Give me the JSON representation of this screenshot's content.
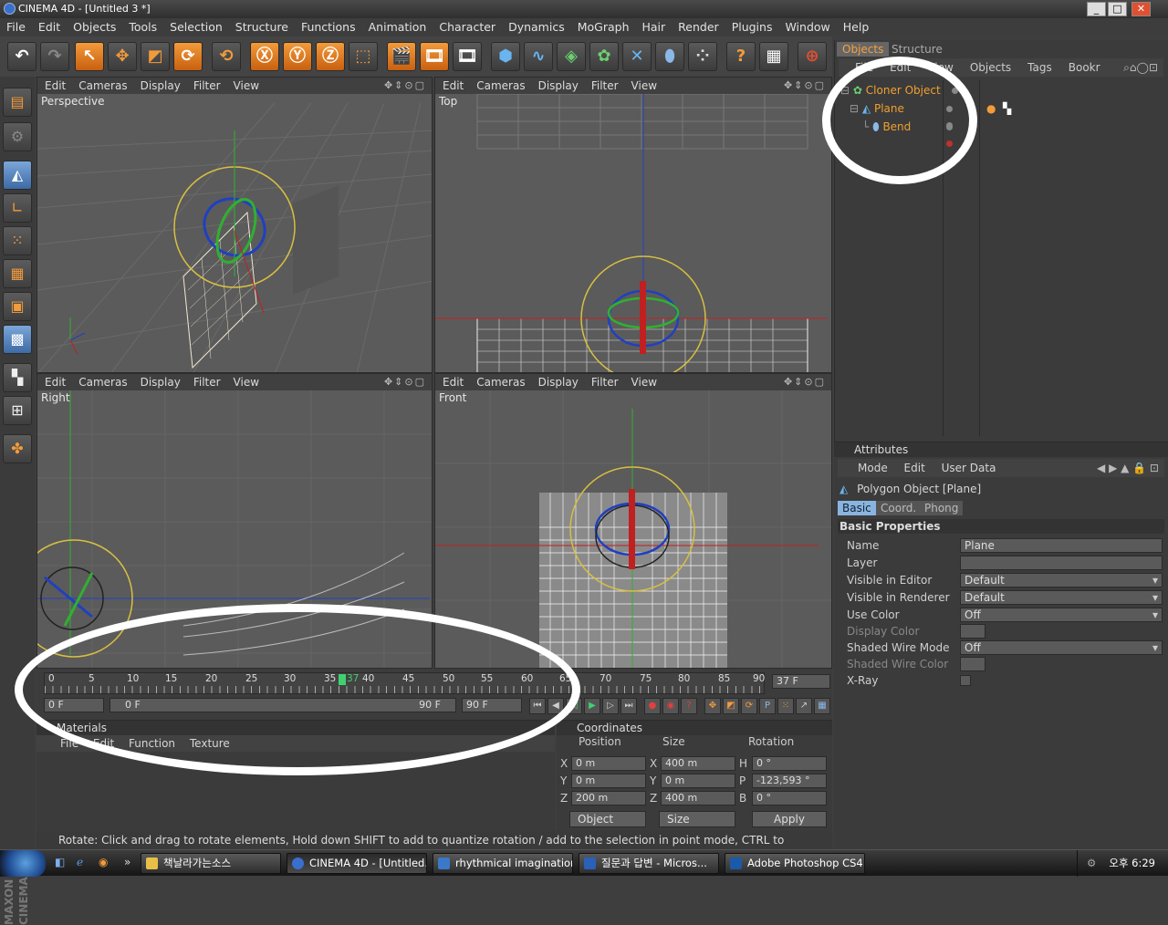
{
  "window": {
    "title": "CINEMA 4D - [Untitled 3 *]",
    "buttons": [
      "_",
      "□",
      "✕"
    ]
  },
  "menu": [
    "File",
    "Edit",
    "Objects",
    "Tools",
    "Selection",
    "Structure",
    "Functions",
    "Animation",
    "Character",
    "Dynamics",
    "MoGraph",
    "Hair",
    "Render",
    "Plugins",
    "Window",
    "Help"
  ],
  "viewport_menu": [
    "Edit",
    "Cameras",
    "Display",
    "Filter",
    "View"
  ],
  "viewport_icons": "✥⇕⊙▢",
  "viewports": {
    "perspective": "Perspective",
    "top": "Top",
    "right": "Right",
    "front": "Front"
  },
  "objects": {
    "tabs": [
      "Objects",
      "Structure"
    ],
    "menu": [
      "File",
      "Edit",
      "View",
      "Objects",
      "Tags",
      "Bookr"
    ],
    "tree": [
      {
        "name": "Cloner Object",
        "color": "#f0a030"
      },
      {
        "name": "Plane",
        "color": "#f0a030"
      },
      {
        "name": "Bend",
        "color": "#f0a030"
      }
    ]
  },
  "attributes": {
    "title": "Attributes",
    "menu": [
      "Mode",
      "Edit",
      "User Data"
    ],
    "object_title": "Polygon Object [Plane]",
    "tabs": [
      "Basic",
      "Coord.",
      "Phong"
    ],
    "section": "Basic Properties",
    "rows": [
      {
        "label": "Name",
        "value": "Plane"
      },
      {
        "label": "Layer",
        "value": ""
      },
      {
        "label": "Visible in Editor",
        "value": "Default"
      },
      {
        "label": "Visible in Renderer",
        "value": "Default"
      },
      {
        "label": "Use Color",
        "value": "Off"
      },
      {
        "label": "Display Color",
        "value": ""
      },
      {
        "label": "Shaded Wire Mode",
        "value": "Off"
      },
      {
        "label": "Shaded Wire Color",
        "value": ""
      },
      {
        "label": "X-Ray",
        "value": ""
      }
    ]
  },
  "timeline": {
    "ticks": [
      "0",
      "5",
      "10",
      "15",
      "20",
      "25",
      "30",
      "35",
      "40",
      "45",
      "50",
      "55",
      "60",
      "65",
      "70",
      "75",
      "80",
      "85",
      "90"
    ],
    "current_marker": "37",
    "current_frame": "37 F",
    "start": "0 F",
    "range_start": "0 F",
    "range_end": "90 F",
    "end": "90 F"
  },
  "materials": {
    "title": "Materials",
    "menu": [
      "File",
      "Edit",
      "Function",
      "Texture"
    ]
  },
  "coordinates": {
    "title": "Coordinates",
    "headers": [
      "Position",
      "Size",
      "Rotation"
    ],
    "rows": [
      {
        "a": "X",
        "pos": "0 m",
        "b": "X",
        "size": "400 m",
        "c": "H",
        "rot": "0 °"
      },
      {
        "a": "Y",
        "pos": "0 m",
        "b": "Y",
        "size": "0 m",
        "c": "P",
        "rot": "-123,593 °"
      },
      {
        "a": "Z",
        "pos": "200 m",
        "b": "Z",
        "size": "400 m",
        "c": "B",
        "rot": "0 °"
      }
    ],
    "mode": "Object",
    "size_mode": "Size",
    "apply": "Apply"
  },
  "status": "Rotate: Click and drag to rotate elements, Hold down SHIFT to add to quantize rotation / add to the selection in point mode, CTRL to remove.",
  "branding": "MAXON CINEMA 4D",
  "taskbar": {
    "tasks": [
      {
        "label": "책날라가는소스",
        "color": "#e8c048"
      },
      {
        "label": "CINEMA 4D - [Untitled...",
        "color": "#3a6fcf"
      },
      {
        "label": "rhythmical imagination...",
        "color": "#3a78c8"
      },
      {
        "label": "질문과 답변 - Micros...",
        "color": "#2a60b8"
      },
      {
        "label": "Adobe Photoshop CS4...",
        "color": "#1a5aa8"
      }
    ],
    "clock": "오후 6:29"
  }
}
